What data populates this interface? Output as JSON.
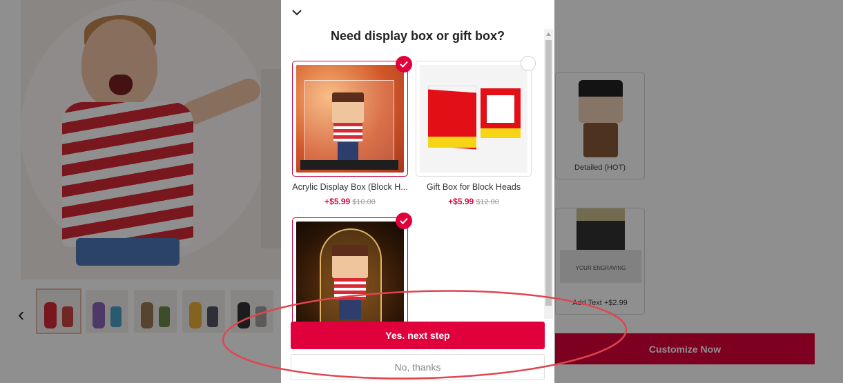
{
  "background": {
    "style_cards": [
      {
        "label": "Detailed (HOT)"
      },
      {
        "label": "Add Text +$2.99",
        "engraving": "YOUR ENGRAVING"
      }
    ],
    "customize_label": "Customize Now"
  },
  "modal": {
    "title": "Need display box or gift box?",
    "options": [
      {
        "name": "Acrylic Display Box (Block H...",
        "price": "+$5.99",
        "original_price": "$10.00",
        "selected": true
      },
      {
        "name": "Gift Box for Block Heads",
        "price": "+$5.99",
        "original_price": "$12.00",
        "selected": false
      },
      {
        "name": "",
        "price": "",
        "original_price": "",
        "selected": true
      }
    ],
    "primary_button": "Yes. next step",
    "secondary_button": "No, thanks"
  },
  "colors": {
    "accent": "#e0003c",
    "annotation": "#e0454f"
  }
}
